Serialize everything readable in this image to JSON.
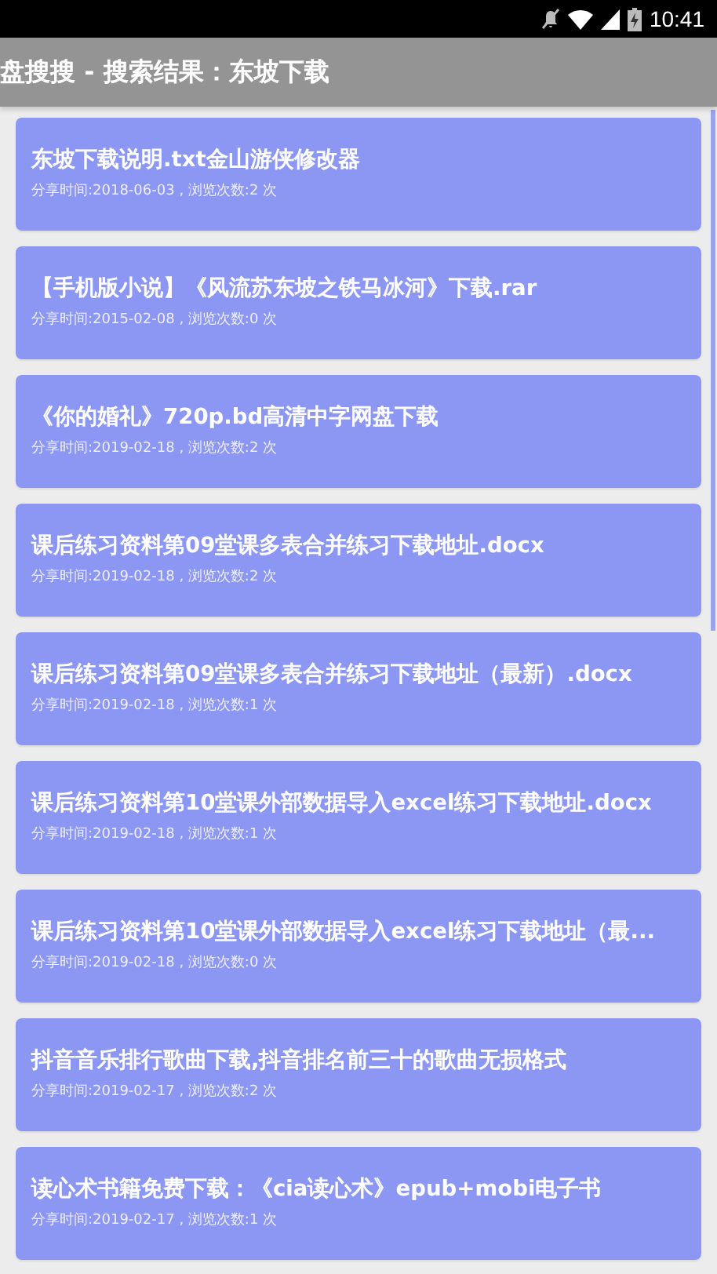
{
  "status_bar": {
    "time": "10:41"
  },
  "app_bar": {
    "title": "盘搜搜 - 搜索结果：东坡下载"
  },
  "results": [
    {
      "title": "东坡下载说明.txt金山游侠修改器",
      "meta": "分享时间:2018-06-03 , 浏览次数:2 次"
    },
    {
      "title": "【手机版小说】《风流苏东坡之铁马冰河》下载.rar",
      "meta": "分享时间:2015-02-08 , 浏览次数:0 次"
    },
    {
      "title": "《你的婚礼》720p.bd高清中字网盘下载",
      "meta": "分享时间:2019-02-18 , 浏览次数:2 次"
    },
    {
      "title": "课后练习资料第09堂课多表合并练习下载地址.docx",
      "meta": "分享时间:2019-02-18 , 浏览次数:2 次"
    },
    {
      "title": "课后练习资料第09堂课多表合并练习下载地址（最新）.docx",
      "meta": "分享时间:2019-02-18 , 浏览次数:1 次"
    },
    {
      "title": "课后练习资料第10堂课外部数据导入excel练习下载地址.docx",
      "meta": "分享时间:2019-02-18 , 浏览次数:1 次"
    },
    {
      "title": "课后练习资料第10堂课外部数据导入excel练习下载地址（最...",
      "meta": "分享时间:2019-02-18 , 浏览次数:0 次"
    },
    {
      "title": "抖音音乐排行歌曲下载,抖音排名前三十的歌曲无损格式",
      "meta": "分享时间:2019-02-17 , 浏览次数:2 次"
    },
    {
      "title": "读心术书籍免费下载：《cia读心术》epub+mobi电子书",
      "meta": "分享时间:2019-02-17 , 浏览次数:1 次"
    }
  ]
}
